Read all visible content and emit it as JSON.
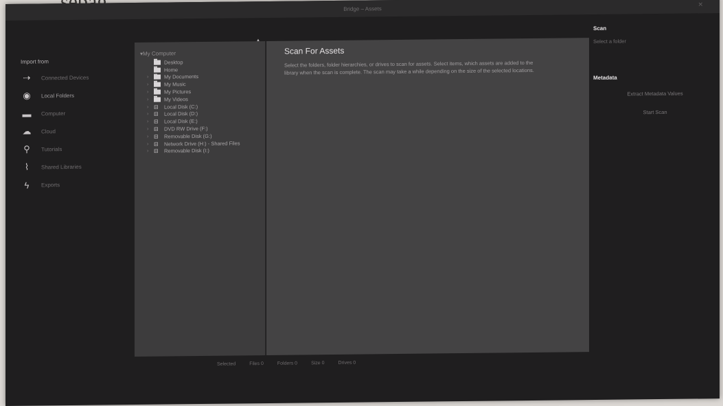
{
  "page": {
    "top_text": "sebag"
  },
  "window": {
    "title": "Bridge – Assets"
  },
  "sidebar": {
    "heading": "Import from",
    "items": [
      {
        "label": "Connected Devices",
        "icon": "arrow-icon"
      },
      {
        "label": "Local Folders",
        "icon": "globe-icon"
      },
      {
        "label": "Computer",
        "icon": "monitor-icon"
      },
      {
        "label": "Cloud",
        "icon": "cloud-icon"
      },
      {
        "label": "Tutorials",
        "icon": "lamp-icon"
      },
      {
        "label": "Shared Libraries",
        "icon": "thermometer-icon"
      },
      {
        "label": "Exports",
        "icon": "flash-icon"
      }
    ]
  },
  "tree": {
    "header": "My Computer",
    "rows": [
      {
        "label": "Desktop",
        "type": "folder",
        "expandable": false
      },
      {
        "label": "Home",
        "type": "folder",
        "expandable": false
      },
      {
        "label": "My Documents",
        "type": "folder",
        "expandable": true
      },
      {
        "label": "My Music",
        "type": "folder",
        "expandable": true
      },
      {
        "label": "My Pictures",
        "type": "folder",
        "expandable": true
      },
      {
        "label": "My Videos",
        "type": "folder",
        "expandable": true
      },
      {
        "label": "Local Disk (C:)",
        "type": "drive",
        "expandable": true
      },
      {
        "label": "Local Disk (D:)",
        "type": "drive",
        "expandable": true
      },
      {
        "label": "Local Disk (E:)",
        "type": "drive",
        "expandable": true
      },
      {
        "label": "DVD RW Drive (F:)",
        "type": "drive",
        "expandable": true
      },
      {
        "label": "Removable Disk (G:)",
        "type": "drive",
        "expandable": true
      },
      {
        "label": "Network Drive (H:) - Shared Files",
        "type": "drive",
        "expandable": true
      },
      {
        "label": "Removable Disk (I:)",
        "type": "drive",
        "expandable": true
      }
    ]
  },
  "main": {
    "title": "Scan For Assets",
    "description": "Select the folders, folder hierarchies, or drives to scan for assets. Select items, which assets are added to the library when the scan is complete. The scan may take a while depending on the size of the selected locations."
  },
  "inspector": {
    "label": "Scan",
    "sub_label": "Select a folder",
    "section_label": "Metadata",
    "buttons": [
      "Extract Metadata Values",
      "Start Scan"
    ]
  },
  "status": {
    "items": [
      "Selected",
      "Files 0",
      "Folders 0",
      "Size 0",
      "Drives 0"
    ]
  },
  "colors": {
    "background": "#1f1e1f",
    "panel": "#3d3c3d",
    "main_panel": "#444344",
    "text": "#e4e1e3"
  }
}
